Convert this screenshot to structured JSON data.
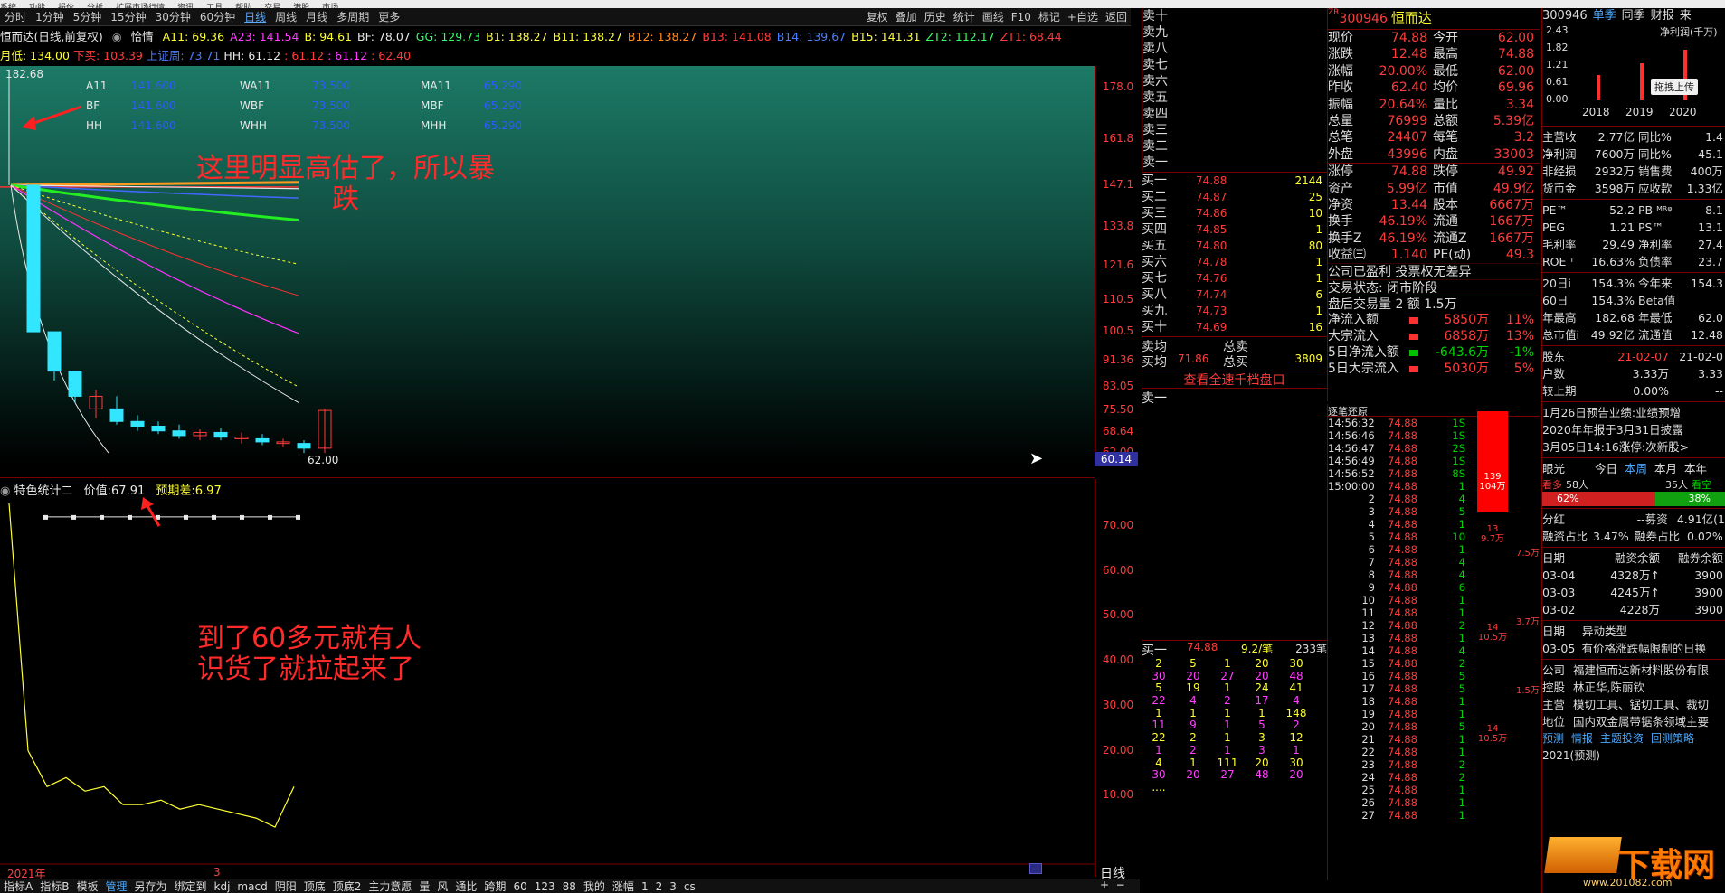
{
  "menubar": [
    "系统",
    "功能",
    "报价",
    "分析",
    "扩展市场行情",
    "资讯",
    "工具",
    "帮助",
    "交易",
    "港股",
    "市场"
  ],
  "toolbar": {
    "left": [
      "分时",
      "1分钟",
      "5分钟",
      "15分钟",
      "30分钟",
      "60分钟",
      "日线",
      "周线",
      "月线",
      "多周期",
      "更多"
    ],
    "active": "日线",
    "right": [
      "复权",
      "叠加",
      "历史",
      "统计",
      "画线",
      "F10",
      "标记",
      "+自选",
      "返回"
    ]
  },
  "header1": {
    "title": "恒而达(日线,前复权)",
    "mode": "恰情",
    "items": [
      {
        "label": "A11:",
        "value": "69.36",
        "color": "#ffff33"
      },
      {
        "label": "A23:",
        "value": "141.54",
        "color": "#ff40ff"
      },
      {
        "label": "B:",
        "value": "94.61",
        "color": "#ffff33"
      },
      {
        "label": "BF:",
        "value": "78.07",
        "color": "#e8e8e8"
      },
      {
        "label": "GG:",
        "value": "129.73",
        "color": "#33ff66"
      },
      {
        "label": "B1:",
        "value": "138.27",
        "color": "#ffff33"
      },
      {
        "label": "B11:",
        "value": "138.27",
        "color": "#ffff33"
      },
      {
        "label": "B12:",
        "value": "138.27",
        "color": "#ff8c20"
      },
      {
        "label": "B13:",
        "value": "141.08",
        "color": "#ff3c3c"
      },
      {
        "label": "B14:",
        "value": "139.67",
        "color": "#4a7dff"
      },
      {
        "label": "B15:",
        "value": "141.31",
        "color": "#ffff33"
      },
      {
        "label": "ZT2:",
        "value": "112.17",
        "color": "#33ff66"
      },
      {
        "label": "ZT1:",
        "value": "68.44",
        "color": "#ff3c3c"
      }
    ]
  },
  "header2": [
    {
      "text": "月低: 134.00",
      "color": "#ffff33"
    },
    {
      "text": "下买: 103.39",
      "color": "#ff3c3c"
    },
    {
      "text": "上证周: 73.71",
      "color": "#4a7dff"
    },
    {
      "text": "HH: 61.12",
      "color": "#e8e8e8"
    },
    {
      "text": ": 61.12",
      "color": "#ff3c3c"
    },
    {
      "text": ": 61.12",
      "color": "#ff40ff"
    },
    {
      "text": ": 62.40",
      "color": "#ff3c3c"
    }
  ],
  "chart": {
    "top_label": "182.68",
    "low_label": "62.00",
    "current_price": "60.14",
    "price_axis": [
      "178.0",
      "161.8",
      "147.1",
      "133.8",
      "121.6",
      "110.5",
      "100.5",
      "91.36",
      "83.05",
      "75.50",
      "68.64",
      "62.00"
    ],
    "ma_table": [
      [
        "A11",
        "141.600",
        "WA11",
        "73.500",
        "MA11",
        "65.290"
      ],
      [
        "BF",
        "141.600",
        "WBF",
        "73.500",
        "MBF",
        "65.290"
      ],
      [
        "HH",
        "141.600",
        "WHH",
        "73.500",
        "MHH",
        "65.290"
      ]
    ],
    "annotation_top": "这里明显高估了，所以暴\n跌",
    "annotation_bottom": "到了60多元就有人\n识货了就拉起来了",
    "candles": [
      {
        "o": 147.1,
        "c": 100.5,
        "h": 147.1,
        "l": 100.5,
        "up": false
      },
      {
        "o": 100.5,
        "c": 88,
        "h": 100.5,
        "l": 85,
        "up": false
      },
      {
        "o": 88,
        "c": 80,
        "h": 88,
        "l": 78,
        "up": false
      },
      {
        "o": 80,
        "c": 76,
        "h": 82,
        "l": 73,
        "up": true
      },
      {
        "o": 76,
        "c": 72,
        "h": 80,
        "l": 71,
        "up": false
      },
      {
        "o": 72,
        "c": 70.5,
        "h": 74,
        "l": 69,
        "up": false
      },
      {
        "o": 70.5,
        "c": 69,
        "h": 72,
        "l": 68,
        "up": false
      },
      {
        "o": 69,
        "c": 67.5,
        "h": 71,
        "l": 66.5,
        "up": false
      },
      {
        "o": 67.5,
        "c": 68.5,
        "h": 69.5,
        "l": 66,
        "up": true
      },
      {
        "o": 68.5,
        "c": 67,
        "h": 70,
        "l": 66,
        "up": false
      },
      {
        "o": 67,
        "c": 66.5,
        "h": 68.5,
        "l": 65,
        "up": true
      },
      {
        "o": 66.5,
        "c": 65.5,
        "h": 68,
        "l": 64.5,
        "up": false
      },
      {
        "o": 65.5,
        "c": 65,
        "h": 66.5,
        "l": 64,
        "up": true
      },
      {
        "o": 65,
        "c": 63.5,
        "h": 66,
        "l": 62,
        "up": false
      },
      {
        "o": 63.5,
        "c": 75.5,
        "h": 76,
        "l": 62,
        "up": true
      }
    ]
  },
  "subchart": {
    "title": "特色统计二",
    "price_label": "价值:",
    "price_value": "67.91",
    "diff_label": "预期差:",
    "diff_value": "6.97",
    "axis": [
      "70.00",
      "60.00",
      "50.00",
      "40.00",
      "30.00",
      "20.00",
      "10.00"
    ],
    "year_label": "2021年",
    "month_label": "3",
    "period_label": "日线",
    "series": [
      75,
      20,
      12,
      14,
      11,
      12,
      8,
      8,
      9,
      7,
      8,
      7,
      6,
      5,
      3,
      12
    ],
    "dots": [
      72,
      72,
      72,
      72,
      72,
      72,
      72,
      72,
      72,
      72
    ]
  },
  "bottom_tabs": [
    "指标A",
    "指标B",
    "模板",
    "管理",
    "另存为",
    "绑定到",
    "kdj",
    "macd",
    "阴阳",
    "顶底",
    "顶底2",
    "主力意愿",
    "量",
    "风",
    "通比",
    "跨期",
    "60",
    "123",
    "88",
    "我的",
    "涨幅",
    "1",
    "2",
    "3",
    "cs"
  ],
  "bottom_active": "管理",
  "sell_levels": [
    "卖十",
    "卖九",
    "卖八",
    "卖七",
    "卖六",
    "卖五",
    "卖四",
    "卖三",
    "卖二",
    "卖一"
  ],
  "buy_levels": [
    {
      "name": "买一",
      "price": "74.88",
      "vol": "2144"
    },
    {
      "name": "买二",
      "price": "74.87",
      "vol": "25"
    },
    {
      "name": "买三",
      "price": "74.86",
      "vol": "10"
    },
    {
      "name": "买四",
      "price": "74.85",
      "vol": "1"
    },
    {
      "name": "买五",
      "price": "74.80",
      "vol": "80"
    },
    {
      "name": "买六",
      "price": "74.78",
      "vol": "1"
    },
    {
      "name": "买七",
      "price": "74.76",
      "vol": "1"
    },
    {
      "name": "买八",
      "price": "74.74",
      "vol": "6"
    },
    {
      "name": "买九",
      "price": "74.73",
      "vol": "1"
    },
    {
      "name": "买十",
      "price": "74.69",
      "vol": "16"
    }
  ],
  "avg": {
    "sell_label": "卖均",
    "sell_total_label": "总卖",
    "buy_label": "买均",
    "buy_price": "71.86",
    "buy_total_label": "总买",
    "buy_total": "3809"
  },
  "view_full_book": "查看全速千档盘口",
  "sell1_label": "卖一",
  "buy1_summary": {
    "label": "买一",
    "price": "74.88",
    "avg": "9.2/笔",
    "count": "233笔"
  },
  "order_queue": [
    [
      "2",
      "5",
      "1",
      "20",
      "30"
    ],
    [
      "30",
      "20",
      "27",
      "20",
      "48"
    ],
    [
      "5",
      "19",
      "1",
      "24",
      "41"
    ],
    [
      "22",
      "4",
      "2",
      "17",
      "4"
    ],
    [
      "1",
      "1",
      "1",
      "1",
      "148"
    ],
    [
      "11",
      "9",
      "1",
      "5",
      "2"
    ],
    [
      "22",
      "2",
      "1",
      "3",
      "12"
    ],
    [
      "1",
      "2",
      "1",
      "3",
      "1"
    ],
    [
      "4",
      "1",
      "111",
      "20",
      "30"
    ],
    [
      "30",
      "20",
      "27",
      "48",
      "20"
    ],
    [
      "....",
      "",
      "",
      "",
      ""
    ]
  ],
  "quote": {
    "code_prefix": "ZR",
    "code": "300946",
    "name": "恒而达",
    "rows": [
      [
        "现价",
        "74.88",
        "今开",
        "62.00"
      ],
      [
        "涨跌",
        "12.48",
        "最高",
        "74.88"
      ],
      [
        "涨幅",
        "20.00%",
        "最低",
        "62.00"
      ],
      [
        "昨收",
        "62.40",
        "均价",
        "69.96"
      ],
      [
        "振幅",
        "20.64%",
        "量比",
        "3.34"
      ],
      [
        "总量",
        "76999",
        "总额",
        "5.39亿"
      ],
      [
        "总笔",
        "24407",
        "每笔",
        "3.2"
      ],
      [
        "外盘",
        "43996",
        "内盘",
        "33003"
      ]
    ],
    "rows2": [
      [
        "涨停",
        "74.88",
        "跌停",
        "49.92"
      ],
      [
        "资产",
        "5.99亿",
        "市值",
        "49.9亿"
      ],
      [
        "净资",
        "13.44",
        "股本",
        "6667万"
      ],
      [
        "换手",
        "46.19%",
        "流通",
        "1667万"
      ],
      [
        "换手Z",
        "46.19%",
        "流通Z",
        "1667万"
      ],
      [
        "收益㈢",
        "1.140",
        "PE(动)",
        "49.3"
      ]
    ],
    "notes": [
      "公司已盈利 投票权无差异",
      "交易状态: 闭市阶段",
      "盘后交易量 2 额 1.5万"
    ],
    "flows": [
      [
        "净流入额",
        "5850万",
        "11%"
      ],
      [
        "大宗流入",
        "6858万",
        "13%"
      ],
      [
        "5日净流入额",
        "-643.6万",
        "-1%"
      ],
      [
        "5日大宗流入",
        "5030万",
        "5%"
      ]
    ]
  },
  "ticks_header": "逐笔还原",
  "ticks": [
    [
      "14:56:32",
      "74.88",
      "1S"
    ],
    [
      "14:56:46",
      "74.88",
      "1S"
    ],
    [
      "14:56:47",
      "74.88",
      "2S"
    ],
    [
      "14:56:49",
      "74.88",
      "1S"
    ],
    [
      "14:56:52",
      "74.88",
      "8S"
    ],
    [
      "15:00:00",
      "74.88",
      "1"
    ],
    [
      "2",
      "74.88",
      "4"
    ],
    [
      "3",
      "74.88",
      "5"
    ],
    [
      "4",
      "74.88",
      "1"
    ],
    [
      "5",
      "74.88",
      "10"
    ],
    [
      "6",
      "74.88",
      "1"
    ],
    [
      "7",
      "74.88",
      "4"
    ],
    [
      "8",
      "74.88",
      "4"
    ],
    [
      "9",
      "74.88",
      "6"
    ],
    [
      "10",
      "74.88",
      "1"
    ],
    [
      "11",
      "74.88",
      "1"
    ],
    [
      "12",
      "74.88",
      "2"
    ],
    [
      "13",
      "74.88",
      "1"
    ],
    [
      "14",
      "74.88",
      "4"
    ],
    [
      "15",
      "74.88",
      "2"
    ],
    [
      "16",
      "74.88",
      "5"
    ],
    [
      "17",
      "74.88",
      "5"
    ],
    [
      "18",
      "74.88",
      "1"
    ],
    [
      "19",
      "74.88",
      "1"
    ],
    [
      "20",
      "74.88",
      "5"
    ],
    [
      "21",
      "74.88",
      "1"
    ],
    [
      "22",
      "74.88",
      "1"
    ],
    [
      "23",
      "74.88",
      "2"
    ],
    [
      "24",
      "74.88",
      "2"
    ],
    [
      "25",
      "74.88",
      "1"
    ],
    [
      "26",
      "74.88",
      "1"
    ],
    [
      "27",
      "74.88",
      "1"
    ]
  ],
  "tick_bars": [
    {
      "label": "139\n104万"
    },
    {
      "label": "13\n9.7万"
    },
    {
      "label": "14\n10.5万"
    },
    {
      "label": "14\n10.5万"
    }
  ],
  "tick_side": [
    "7.5万",
    "3.7万",
    "1.5万"
  ],
  "right": {
    "code": "300946",
    "tabs": [
      "单季",
      "同季",
      "财报",
      "来"
    ],
    "chart_title": "净利润(千万)",
    "chart_axis": [
      "2.43",
      "1.82",
      "1.21",
      "0.61",
      "0.00"
    ],
    "chart_years": [
      "2018",
      "2019",
      "2020"
    ],
    "chart_bars": [
      0.9,
      1.3,
      1.8
    ],
    "badge": "拖拽上传",
    "fin": [
      [
        "主营收",
        "2.77亿",
        "同比%",
        "1.4"
      ],
      [
        "净利润",
        "7600万",
        "同比%",
        "45.1"
      ],
      [
        "非经损",
        "2932万",
        "销售费",
        "400万"
      ],
      [
        "货币金",
        "3598万",
        "应收款",
        "1.33亿"
      ]
    ],
    "ratios": [
      [
        "PE™",
        "52.2",
        "PB ᴹᴿᵠ",
        "8.1"
      ],
      [
        "PEG",
        "1.21",
        "PS™",
        "13.1"
      ],
      [
        "毛利率",
        "29.49",
        "净利率",
        "27.4"
      ],
      [
        "ROE ᵀ",
        "16.63%",
        "负债率",
        "23.7"
      ]
    ],
    "perf": [
      [
        "20日i",
        "154.3%",
        "今年来",
        "154.3"
      ],
      [
        "60日",
        "154.3%",
        "Beta值",
        ""
      ],
      [
        "年最高",
        "182.68",
        "年最低",
        "62.0"
      ],
      [
        "总市值i",
        "49.92亿",
        "流通值",
        "12.48"
      ]
    ],
    "holders": [
      [
        "股东",
        "21-02-07",
        "21-02-0"
      ],
      [
        "户数",
        "3.33万",
        "3.33"
      ],
      [
        "较上期",
        "0.00%",
        "--"
      ]
    ],
    "news": [
      "1月26日预告业绩:业绩预增",
      "2020年年报于3月31日披露",
      "3月05日14:16涨停:次新股>"
    ],
    "vote": {
      "label": "眼光",
      "tabs": [
        "今日",
        "本周",
        "本月",
        "本年"
      ],
      "bull_label": "看多",
      "bull_count": "58人",
      "bear_count": "35人",
      "bear_label": "看空",
      "bull_pct": "62%",
      "bear_pct": "38%"
    },
    "dividend": [
      "分红",
      "--募资",
      "4.91亿(1"
    ],
    "margin": [
      "融资占比",
      "3.47%",
      "融券占比",
      "0.02%"
    ],
    "margin_hdr": [
      "日期",
      "融资余额",
      "融券余额"
    ],
    "margin_rows": [
      [
        "03-04",
        "4328万↑",
        "3900"
      ],
      [
        "03-03",
        "4245万↑",
        "3900"
      ],
      [
        "03-02",
        "4228万",
        "3900"
      ]
    ],
    "anomaly_hdr": [
      "日期",
      "异动类型"
    ],
    "anomaly_row": [
      "03-05",
      "有价格涨跌幅限制的日换"
    ],
    "company": [
      [
        "公司",
        "福建恒而达新材料股份有限"
      ],
      [
        "控股",
        "林正华,陈丽钦"
      ],
      [
        "主营",
        "模切工具、锯切工具、裁切"
      ],
      [
        "地位",
        "国内双金属带锯条领域主要"
      ]
    ],
    "footer": [
      "预测",
      "情报",
      "主题投资",
      "回测策略"
    ],
    "footer2": "2021(预测)"
  },
  "watermark": {
    "text": "下载网",
    "url": "www.201082.com"
  }
}
